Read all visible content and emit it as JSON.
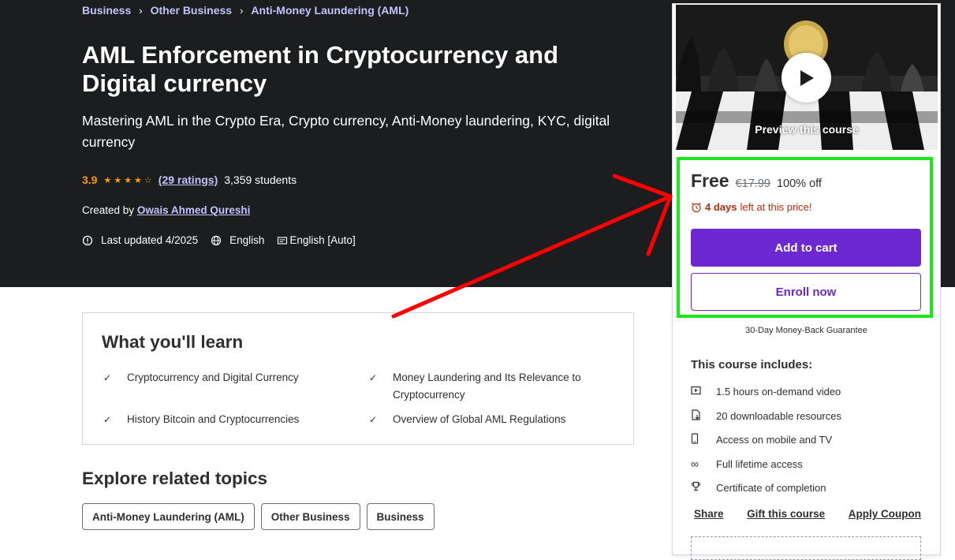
{
  "breadcrumb": [
    "Business",
    "Other Business",
    "Anti-Money Laundering (AML)"
  ],
  "course": {
    "title": "AML Enforcement in Cryptocurrency and Digital currency",
    "subtitle": "Mastering AML in the Crypto Era, Crypto currency, Anti-Money laundering, KYC, digital currency",
    "rating": "3.9",
    "stars_filled": 4,
    "ratings_link": "(29 ratings)",
    "students": "3,359 students",
    "created_by_label": "Created by",
    "author": "Owais Ahmed Qureshi",
    "last_updated": "Last updated 4/2025",
    "language": "English",
    "captions": "English [Auto]"
  },
  "learn": {
    "title": "What you'll learn",
    "items": [
      "Cryptocurrency and Digital Currency",
      "Money Laundering and Its Relevance to Cryptocurrency",
      "History Bitcoin and Cryptocurrencies",
      "Overview of Global AML Regulations"
    ]
  },
  "explore": {
    "title": "Explore related topics",
    "topics": [
      "Anti-Money Laundering (AML)",
      "Other Business",
      "Business"
    ]
  },
  "sidebar": {
    "preview_label": "Preview this course",
    "price": "Free",
    "original_price": "€17.99",
    "discount": "100% off",
    "timer_bold": "4 days",
    "timer_rest": "left at this price!",
    "add_to_cart": "Add to cart",
    "enroll_now": "Enroll now",
    "guarantee": "30-Day Money-Back Guarantee",
    "includes_title": "This course includes:",
    "includes": [
      {
        "icon": "video-icon",
        "text": "1.5 hours on-demand video"
      },
      {
        "icon": "file-download-icon",
        "text": "20 downloadable resources"
      },
      {
        "icon": "mobile-icon",
        "text": "Access on mobile and TV"
      },
      {
        "icon": "infinity-icon",
        "text": "Full lifetime access"
      },
      {
        "icon": "trophy-icon",
        "text": "Certificate of completion"
      }
    ],
    "links": [
      "Share",
      "Gift this course",
      "Apply Coupon"
    ]
  },
  "colors": {
    "hero_bg": "#1c1d1f",
    "accent_purple": "#6d28d2",
    "link_lavender": "#c0c4fc",
    "star_orange": "#f69c08",
    "timer_red": "#b32d0f",
    "highlight_green": "#1ee61e",
    "annotation_red": "#ff0000"
  }
}
